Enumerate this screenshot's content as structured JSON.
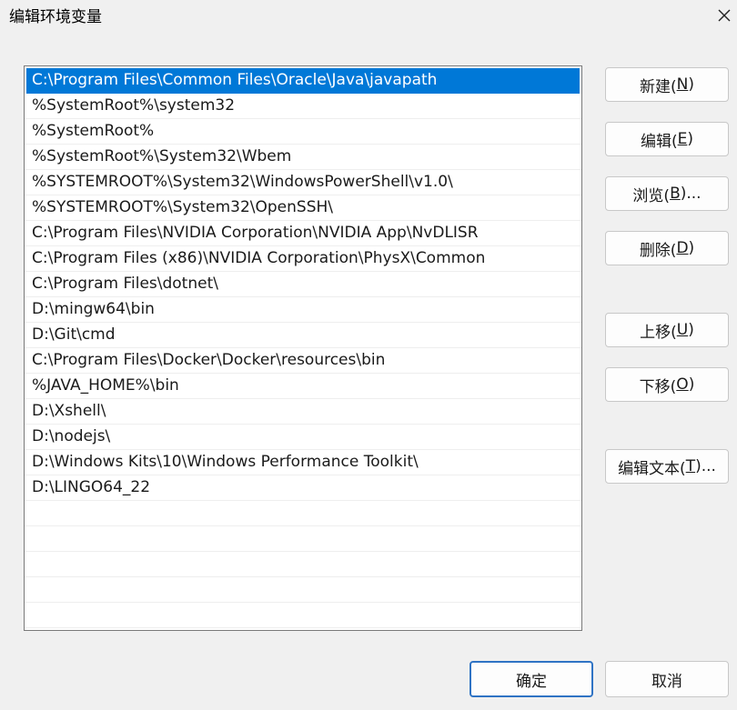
{
  "window": {
    "title": "编辑环境变量"
  },
  "path_list": {
    "items": [
      "C:\\Program Files\\Common Files\\Oracle\\Java\\javapath",
      "%SystemRoot%\\system32",
      "%SystemRoot%",
      "%SystemRoot%\\System32\\Wbem",
      "%SYSTEMROOT%\\System32\\WindowsPowerShell\\v1.0\\",
      "%SYSTEMROOT%\\System32\\OpenSSH\\",
      "C:\\Program Files\\NVIDIA Corporation\\NVIDIA App\\NvDLISR",
      "C:\\Program Files (x86)\\NVIDIA Corporation\\PhysX\\Common",
      "C:\\Program Files\\dotnet\\",
      "D:\\mingw64\\bin",
      "D:\\Git\\cmd",
      "C:\\Program Files\\Docker\\Docker\\resources\\bin",
      "%JAVA_HOME%\\bin",
      "D:\\Xshell\\",
      "D:\\nodejs\\",
      "D:\\Windows Kits\\10\\Windows Performance Toolkit\\",
      "D:\\LINGO64_22"
    ]
  },
  "buttons": {
    "new": {
      "label": "新建(",
      "mnemonic": "N",
      "suffix": ")"
    },
    "edit": {
      "label": "编辑(",
      "mnemonic": "E",
      "suffix": ")"
    },
    "browse": {
      "label": "浏览(",
      "mnemonic": "B",
      "suffix": ")..."
    },
    "delete": {
      "label": "删除(",
      "mnemonic": "D",
      "suffix": ")"
    },
    "move_up": {
      "label": "上移(",
      "mnemonic": "U",
      "suffix": ")"
    },
    "move_down": {
      "label": "下移(",
      "mnemonic": "O",
      "suffix": ")"
    },
    "edit_text": {
      "label": "编辑文本(",
      "mnemonic": "T",
      "suffix": ")..."
    },
    "ok": "确定",
    "cancel": "取消"
  },
  "colors": {
    "selection": "#0078d7",
    "default_button_border": "#2f73c4"
  }
}
